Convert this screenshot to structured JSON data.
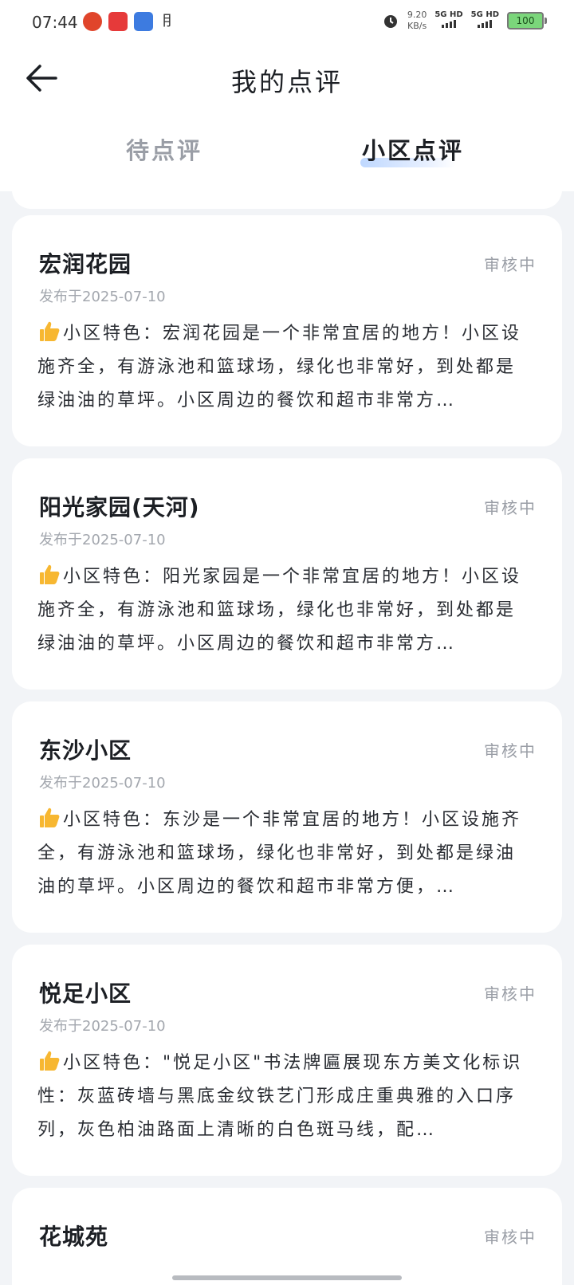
{
  "status_bar": {
    "time": "07:44",
    "net_speed_value": "9.20",
    "net_speed_unit": "KB/s",
    "sim1": "5G HD",
    "sim2": "5G HD",
    "battery": "100"
  },
  "header": {
    "title": "我的点评"
  },
  "tabs": [
    {
      "label": "待点评",
      "active": false
    },
    {
      "label": "小区点评",
      "active": true
    }
  ],
  "reviews": [
    {
      "name": "宏润花园",
      "status": "审核中",
      "date": "发布于2025-07-10",
      "content": "小区特色：宏润花园是一个非常宜居的地方！小区设施齐全，有游泳池和篮球场，绿化也非常好，到处都是绿油油的草坪。小区周边的餐饮和超市非常方…"
    },
    {
      "name": "阳光家园(天河)",
      "status": "审核中",
      "date": "发布于2025-07-10",
      "content": "小区特色：阳光家园是一个非常宜居的地方！小区设施齐全，有游泳池和篮球场，绿化也非常好，到处都是绿油油的草坪。小区周边的餐饮和超市非常方…"
    },
    {
      "name": "东沙小区",
      "status": "审核中",
      "date": "发布于2025-07-10",
      "content": "小区特色：东沙是一个非常宜居的地方！小区设施齐全，有游泳池和篮球场，绿化也非常好，到处都是绿油油的草坪。小区周边的餐饮和超市非常方便，…"
    },
    {
      "name": "悦足小区",
      "status": "审核中",
      "date": "发布于2025-07-10",
      "content": "小区特色：\"悦足小区\"书法牌匾展现东方美文化标识性：灰蓝砖墙与黑底金纹铁艺门形成庄重典雅的入口序列，灰色柏油路面上清晰的白色斑马线，配…"
    },
    {
      "name": "花城苑",
      "status": "审核中"
    }
  ],
  "icons": {
    "back": "arrow-left-icon",
    "review_badge": "thumbs-up-icon"
  },
  "colors": {
    "tab_active_highlight": "#bfd8ff",
    "status_text": "#9a9ea6",
    "background": "#f2f4f7"
  }
}
